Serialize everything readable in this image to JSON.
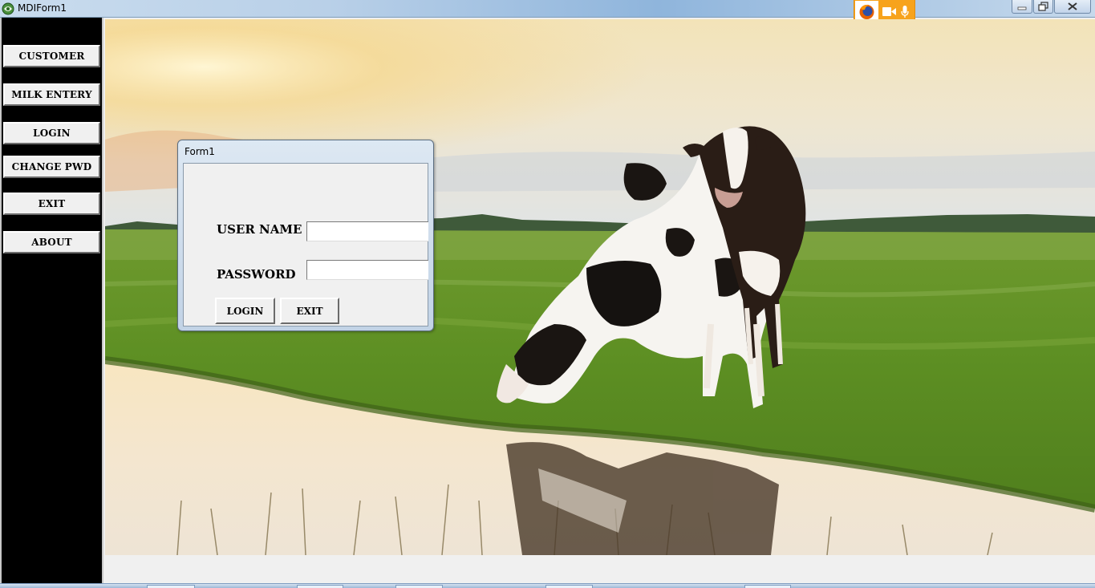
{
  "window": {
    "title": "MDIForm1"
  },
  "sidebar": {
    "items": [
      {
        "label": "CUSTOMER"
      },
      {
        "label": "MILK ENTERY"
      },
      {
        "label": "LOGIN"
      },
      {
        "label": "CHANGE PWD"
      },
      {
        "label": "EXIT"
      },
      {
        "label": "ABOUT"
      }
    ]
  },
  "login_form": {
    "title": "Form1",
    "username_label": "USER NAME",
    "username_value": "",
    "password_label": "PASSWORD",
    "password_value": "",
    "login_label": "LOGIN",
    "exit_label": "EXIT"
  },
  "icons": {
    "app": "app-icon",
    "browser": "firefox-icon",
    "camera": "camera-icon",
    "microphone": "microphone-icon",
    "minimize": "minimize-icon",
    "restore": "restore-icon",
    "close": "close-icon"
  },
  "colors": {
    "sidebar_bg": "#000000",
    "button_face": "#f0f0f0",
    "sharing_indicator": "#f7a31c"
  }
}
